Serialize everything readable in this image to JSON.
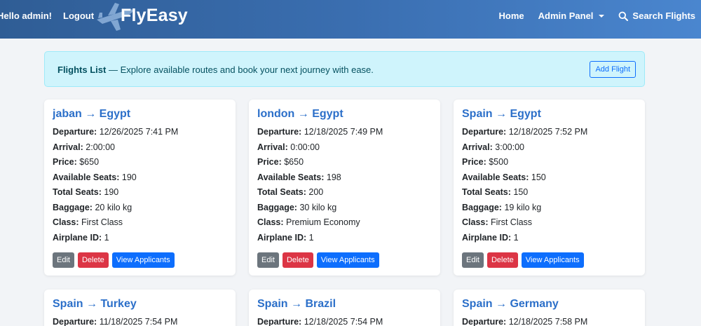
{
  "nav": {
    "greeting": "Hello admin!",
    "logout": "Logout",
    "brand": "FlyEasy",
    "home": "Home",
    "admin_panel": "Admin Panel",
    "search_flights": "Search Flights"
  },
  "banner": {
    "title": "Flights List",
    "text": " — Explore available routes and book your next journey with ease.",
    "add_flight": "Add Flight"
  },
  "labels": {
    "departure": "Departure:",
    "arrival": "Arrival:",
    "price": "Price:",
    "available_seats": "Available Seats:",
    "total_seats": "Total Seats:",
    "baggage": "Baggage:",
    "class": "Class:",
    "airplane_id": "Airplane ID:",
    "edit": "Edit",
    "delete": "Delete",
    "view_applicants": "View Applicants"
  },
  "flights": [
    {
      "route": "jaban → Egypt",
      "departure": "12/26/2025 7:41 PM",
      "arrival": "2:00:00",
      "price": "$650",
      "available_seats": "190",
      "total_seats": "190",
      "baggage": "20 kilo kg",
      "class": "First Class",
      "airplane_id": "1"
    },
    {
      "route": "london → Egypt",
      "departure": "12/18/2025 7:49 PM",
      "arrival": "0:00:00",
      "price": "$650",
      "available_seats": "198",
      "total_seats": "200",
      "baggage": "30 kilo kg",
      "class": "Premium Economy",
      "airplane_id": "1"
    },
    {
      "route": "Spain → Egypt",
      "departure": "12/18/2025 7:52 PM",
      "arrival": "3:00:00",
      "price": "$500",
      "available_seats": "150",
      "total_seats": "150",
      "baggage": "19 kilo kg",
      "class": "First Class",
      "airplane_id": "1"
    },
    {
      "route": "Spain → Turkey",
      "departure": "11/18/2025 7:54 PM"
    },
    {
      "route": "Spain → Brazil",
      "departure": "12/18/2025 7:54 PM"
    },
    {
      "route": "Spain → Germany",
      "departure": "12/18/2025 7:58 PM"
    }
  ]
}
